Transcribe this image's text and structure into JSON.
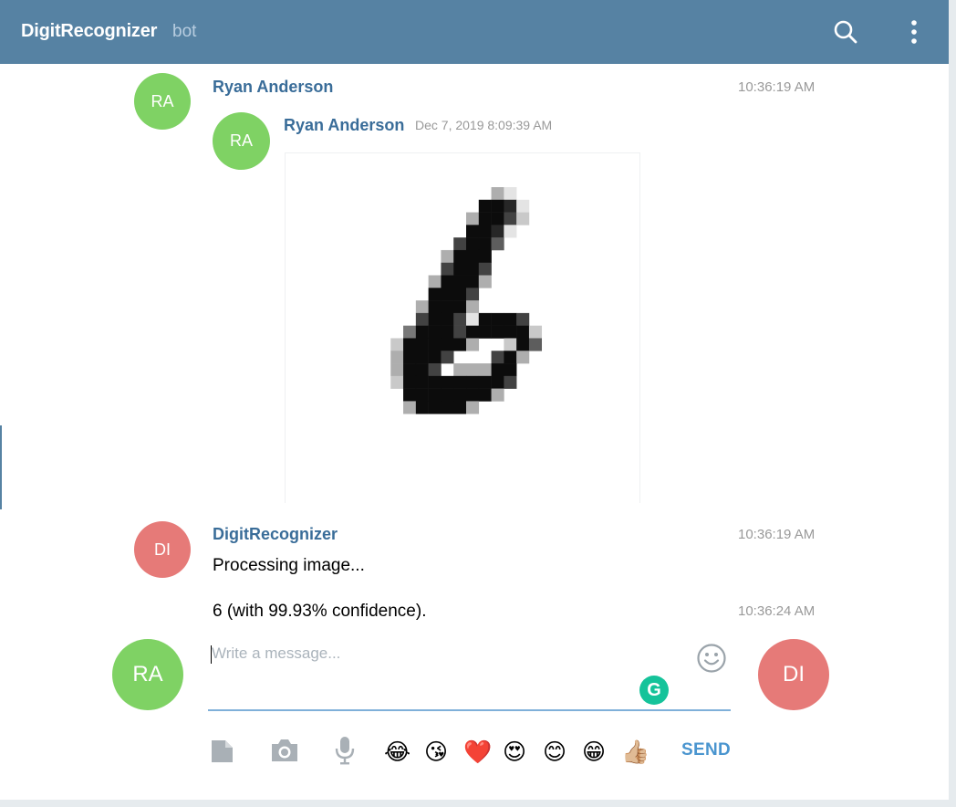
{
  "header": {
    "title": "DigitRecognizer",
    "subtitle": "bot"
  },
  "messages": [
    {
      "avatar": "RA",
      "sender": "Ryan Anderson",
      "time": "10:36:19 AM",
      "forwarded": {
        "avatar": "RA",
        "sender": "Ryan Anderson",
        "date": "Dec 7, 2019 8:09:39 AM",
        "image": "handwritten-digit-6"
      }
    },
    {
      "avatar": "DI",
      "sender": "DigitRecognizer",
      "time": "10:36:19 AM",
      "text": "Processing image..."
    },
    {
      "text": "6 (with 99.93% confidence).",
      "time": "10:36:24 AM"
    }
  ],
  "composer": {
    "placeholder": "Write a message...",
    "my_avatar": "RA",
    "peer_avatar": "DI",
    "send_label": "SEND",
    "tools": [
      "file-icon",
      "camera-icon",
      "microphone-icon"
    ],
    "emojis": [
      "😂",
      "😘",
      "❤️",
      "😍",
      "😊",
      "😁",
      "👍🏼"
    ]
  },
  "colors": {
    "header": "#5682a3",
    "avatar_green": "#7fd264",
    "avatar_red": "#e67a78",
    "name": "#3a6d99",
    "send": "#4a95cf"
  }
}
